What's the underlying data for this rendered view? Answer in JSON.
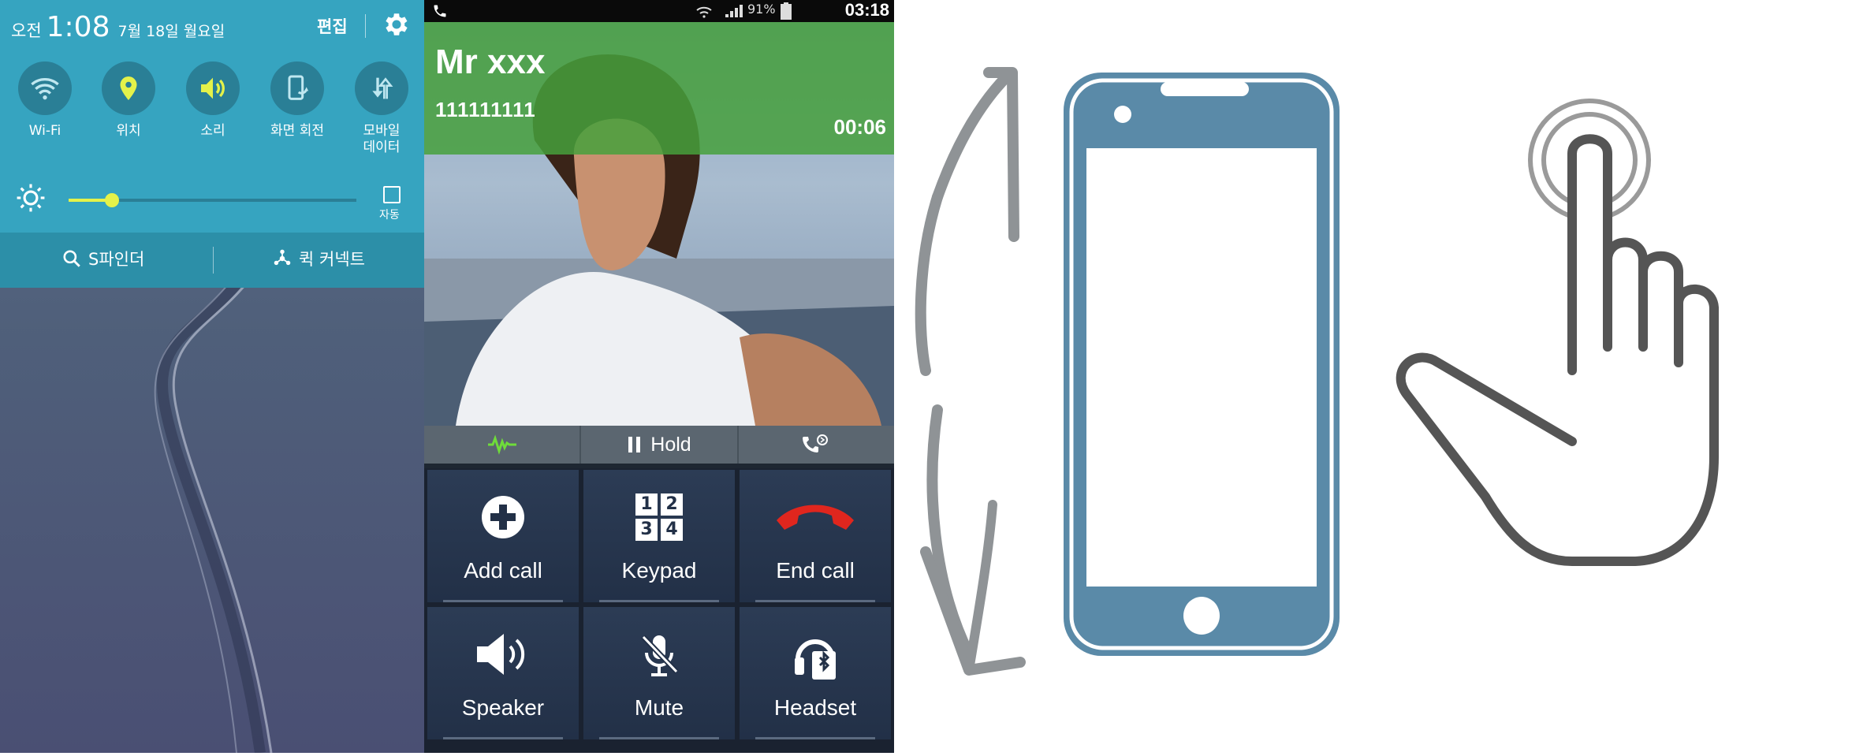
{
  "quick_settings": {
    "ampm": "오전",
    "time": "1:08",
    "date": "7월 18일 월요일",
    "edit_label": "편집",
    "tiles": [
      {
        "label": "Wi-Fi",
        "icon": "wifi-icon"
      },
      {
        "label": "위치",
        "icon": "location-icon"
      },
      {
        "label": "소리",
        "icon": "volume-icon"
      },
      {
        "label": "화면 회전",
        "icon": "screen-rotation-icon"
      },
      {
        "label": "모바일\n데이터",
        "icon": "mobile-data-icon"
      }
    ],
    "brightness_level": 0.15,
    "auto_label": "자동",
    "s_finder_label": "S파인더",
    "quick_connect_label": "퀵 커넥트",
    "colors": {
      "panel": "#36a4c0",
      "accent": "#e4f24a",
      "tile": "#2a7f96"
    }
  },
  "call_screen": {
    "status": {
      "battery": "91%",
      "time": "03:18"
    },
    "contact_name": "Mr xxx",
    "number": "111111111",
    "duration": "00:06",
    "hold_label": "Hold",
    "buttons": [
      {
        "label": "Add call",
        "icon": "add-call-icon"
      },
      {
        "label": "Keypad",
        "icon": "keypad-icon"
      },
      {
        "label": "End call",
        "icon": "end-call-icon"
      },
      {
        "label": "Speaker",
        "icon": "speaker-icon"
      },
      {
        "label": "Mute",
        "icon": "mute-icon"
      },
      {
        "label": "Headset",
        "icon": "headset-icon"
      }
    ],
    "keypad_digits": [
      "1",
      "2",
      "3",
      "4"
    ]
  },
  "illustrations": {
    "rotate": {
      "icon": "phone-rotate-icon",
      "color": "#5a8aa8"
    },
    "tap": {
      "icon": "finger-tap-icon",
      "color": "#555555"
    }
  }
}
